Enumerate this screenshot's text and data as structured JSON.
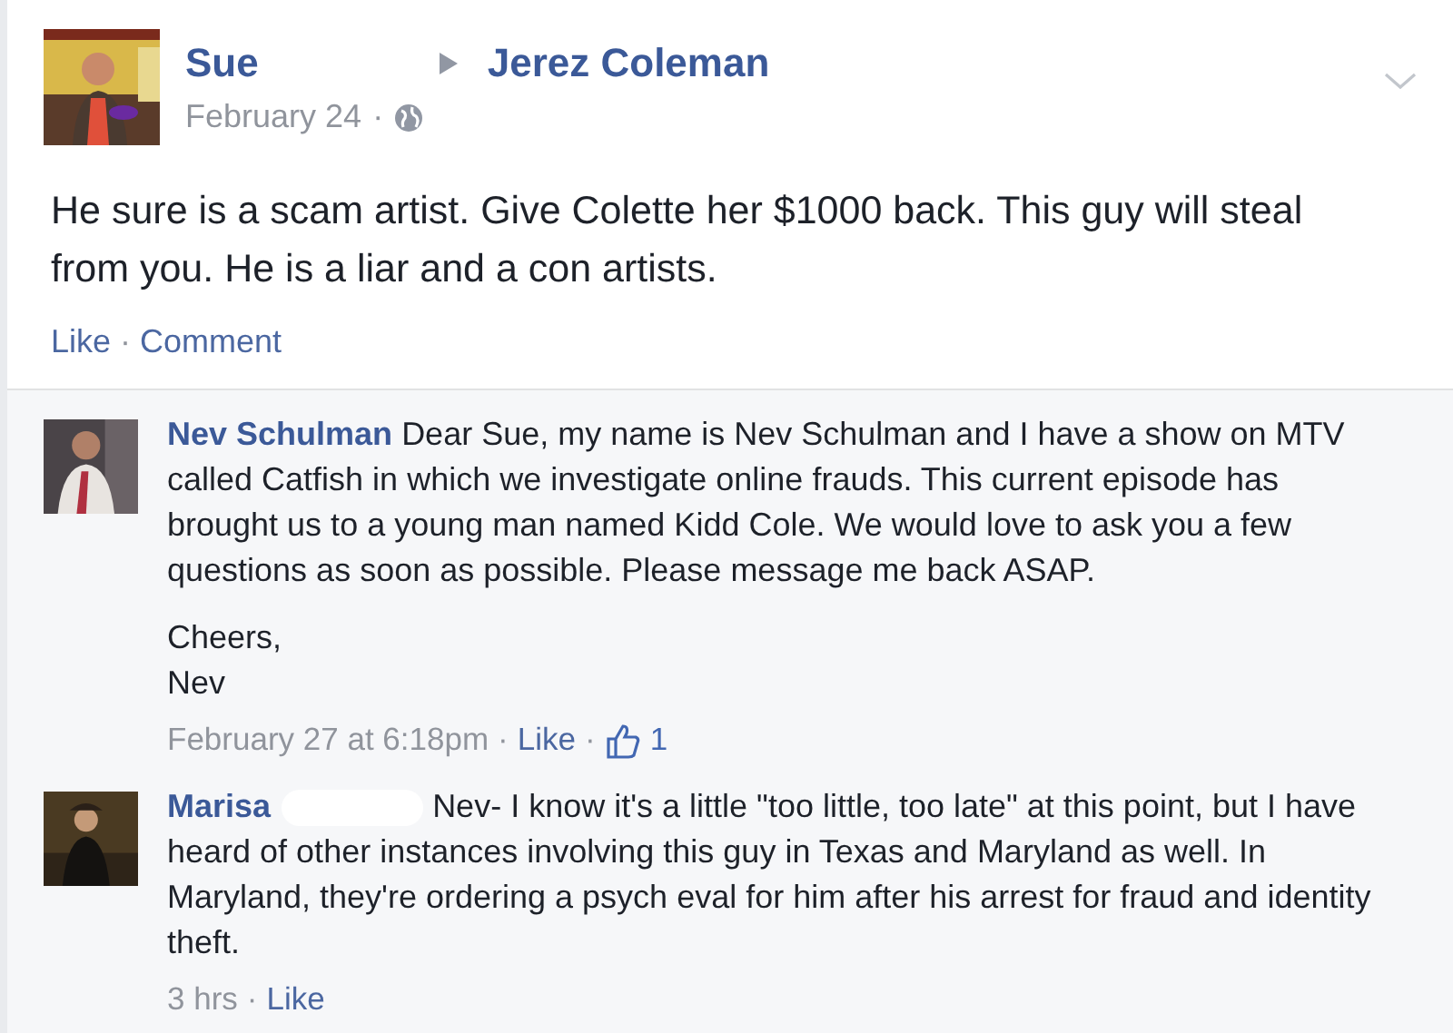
{
  "post": {
    "author": "Sue",
    "target": "Jerez Coleman",
    "time": "February 24",
    "separator": "·",
    "text": "He sure is a scam artist. Give Colette her $1000 back. This guy will steal from you. He is a liar and a con artists.",
    "actions": [
      "Like",
      "Comment"
    ]
  },
  "comments": [
    {
      "author": "Nev Schulman",
      "paragraphs": [
        "Dear Sue, my name is Nev Schulman and I have a show on MTV called Catfish in which we investigate online frauds. This current episode has brought us to a young man named Kidd Cole. We would love to ask you a few questions as soon as possible. Please message me back ASAP.",
        "Cheers,\nNev"
      ],
      "time": "February 27 at 6:18pm",
      "like": "Like",
      "likes": "1"
    },
    {
      "author": "Marisa",
      "redacted_surname": true,
      "paragraphs": [
        "Nev- I know it's a little \"too little, too late\" at this point, but I have heard of other instances involving this guy in Texas and Maryland as well. In Maryland, they're ordering a psych eval for him after his arrest for fraud and identity theft."
      ],
      "time": "3 hrs",
      "like": "Like"
    }
  ]
}
